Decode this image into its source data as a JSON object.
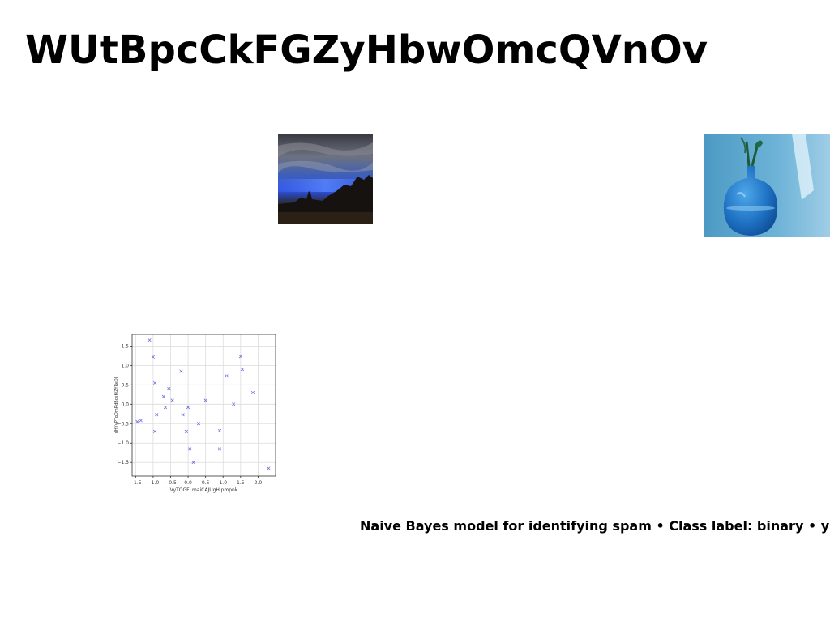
{
  "title": "WUtBpcCkFGZyHbwOmcQVnOv",
  "images": {
    "sky": "dusky-sky-photo",
    "vase": "blue-glass-vase-photo"
  },
  "caption": "Naive Bayes model for identifying spam • Class label: binary • y",
  "chart_data": {
    "type": "scatter",
    "title": "",
    "xlabel": "VyTOGFLmaiCAJUgHipmpnk",
    "ylabel": "dHYyPTqDmRdBcxKiZYReDJ",
    "xlim": [
      -1.6,
      2.5
    ],
    "ylim": [
      -1.85,
      1.8
    ],
    "xticks": [
      "−1.5",
      "−1.0",
      "−0.5",
      "0.0",
      "0.5",
      "1.0",
      "1.5",
      "2.0"
    ],
    "xtick_values": [
      -1.5,
      -1.0,
      -0.5,
      0.0,
      0.5,
      1.0,
      1.5,
      2.0
    ],
    "yticks": [
      "−1.5",
      "−1.0",
      "−0.5",
      "0.0",
      "0.5",
      "1.0",
      "1.5"
    ],
    "ytick_values": [
      -1.5,
      -1.0,
      -0.5,
      0.0,
      0.5,
      1.0,
      1.5
    ],
    "grid": true,
    "marker": "x",
    "color": "#6f6fe6",
    "points": [
      [
        -1.45,
        -0.45
      ],
      [
        -1.35,
        -0.42
      ],
      [
        -1.1,
        1.65
      ],
      [
        -1.0,
        1.22
      ],
      [
        -0.95,
        0.55
      ],
      [
        -0.95,
        -0.7
      ],
      [
        -0.9,
        -0.27
      ],
      [
        -0.7,
        0.2
      ],
      [
        -0.65,
        -0.08
      ],
      [
        -0.55,
        0.4
      ],
      [
        -0.45,
        0.1
      ],
      [
        -0.2,
        0.85
      ],
      [
        -0.15,
        -0.27
      ],
      [
        -0.05,
        -0.7
      ],
      [
        0.0,
        -0.08
      ],
      [
        0.05,
        -1.15
      ],
      [
        0.15,
        -1.5
      ],
      [
        0.3,
        -0.5
      ],
      [
        0.5,
        0.1
      ],
      [
        0.9,
        -0.68
      ],
      [
        0.9,
        -1.15
      ],
      [
        1.1,
        0.73
      ],
      [
        1.3,
        0.0
      ],
      [
        1.5,
        1.23
      ],
      [
        1.55,
        0.9
      ],
      [
        1.85,
        0.3
      ],
      [
        2.3,
        -1.65
      ]
    ]
  }
}
